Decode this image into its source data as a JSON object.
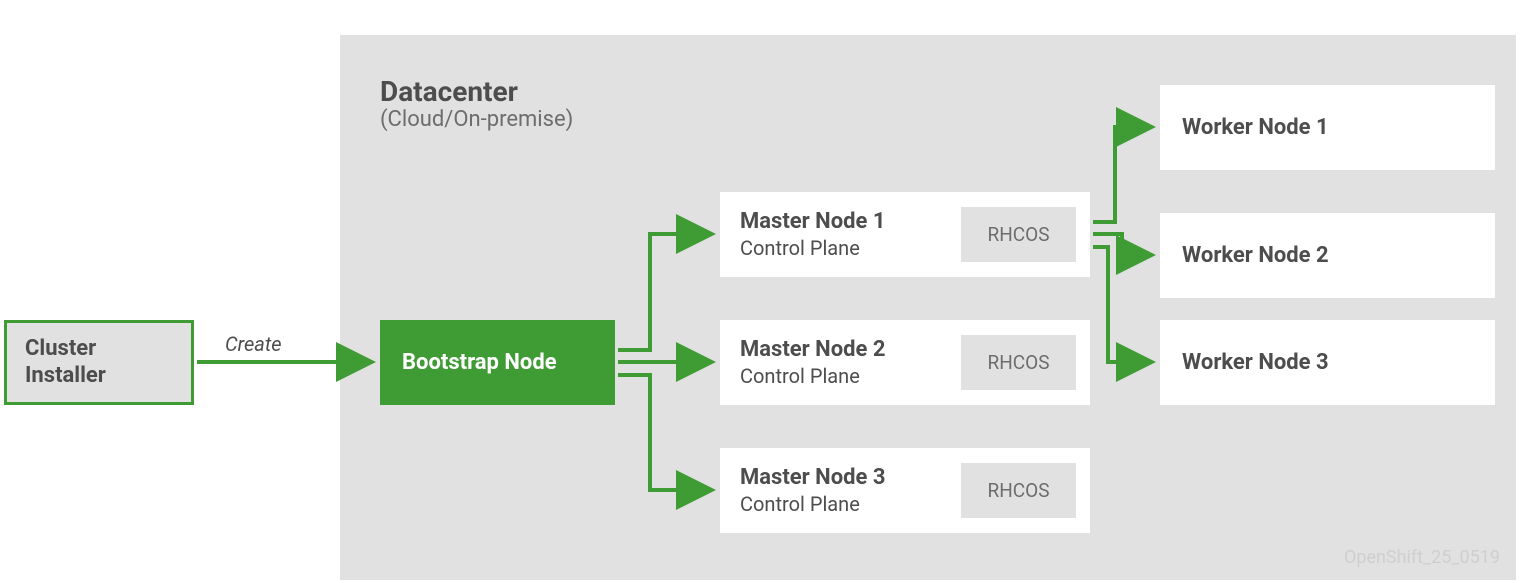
{
  "datacenter": {
    "title": "Datacenter",
    "subtitle": "(Cloud/On-premise)"
  },
  "cluster_installer": {
    "line1": "Cluster",
    "line2": "Installer"
  },
  "create_label": "Create",
  "bootstrap": {
    "label": "Bootstrap Node"
  },
  "masters": [
    {
      "title": "Master Node 1",
      "sub": "Control Plane",
      "tag": "RHCOS"
    },
    {
      "title": "Master Node 2",
      "sub": "Control Plane",
      "tag": "RHCOS"
    },
    {
      "title": "Master Node 3",
      "sub": "Control Plane",
      "tag": "RHCOS"
    }
  ],
  "workers": [
    {
      "label": "Worker Node 1"
    },
    {
      "label": "Worker Node 2"
    },
    {
      "label": "Worker Node 3"
    }
  ],
  "footer_id": "OpenShift_25_0519",
  "colors": {
    "green": "#3f9c35",
    "grey_bg": "#e1e1e1",
    "text": "#4d4d4d"
  }
}
